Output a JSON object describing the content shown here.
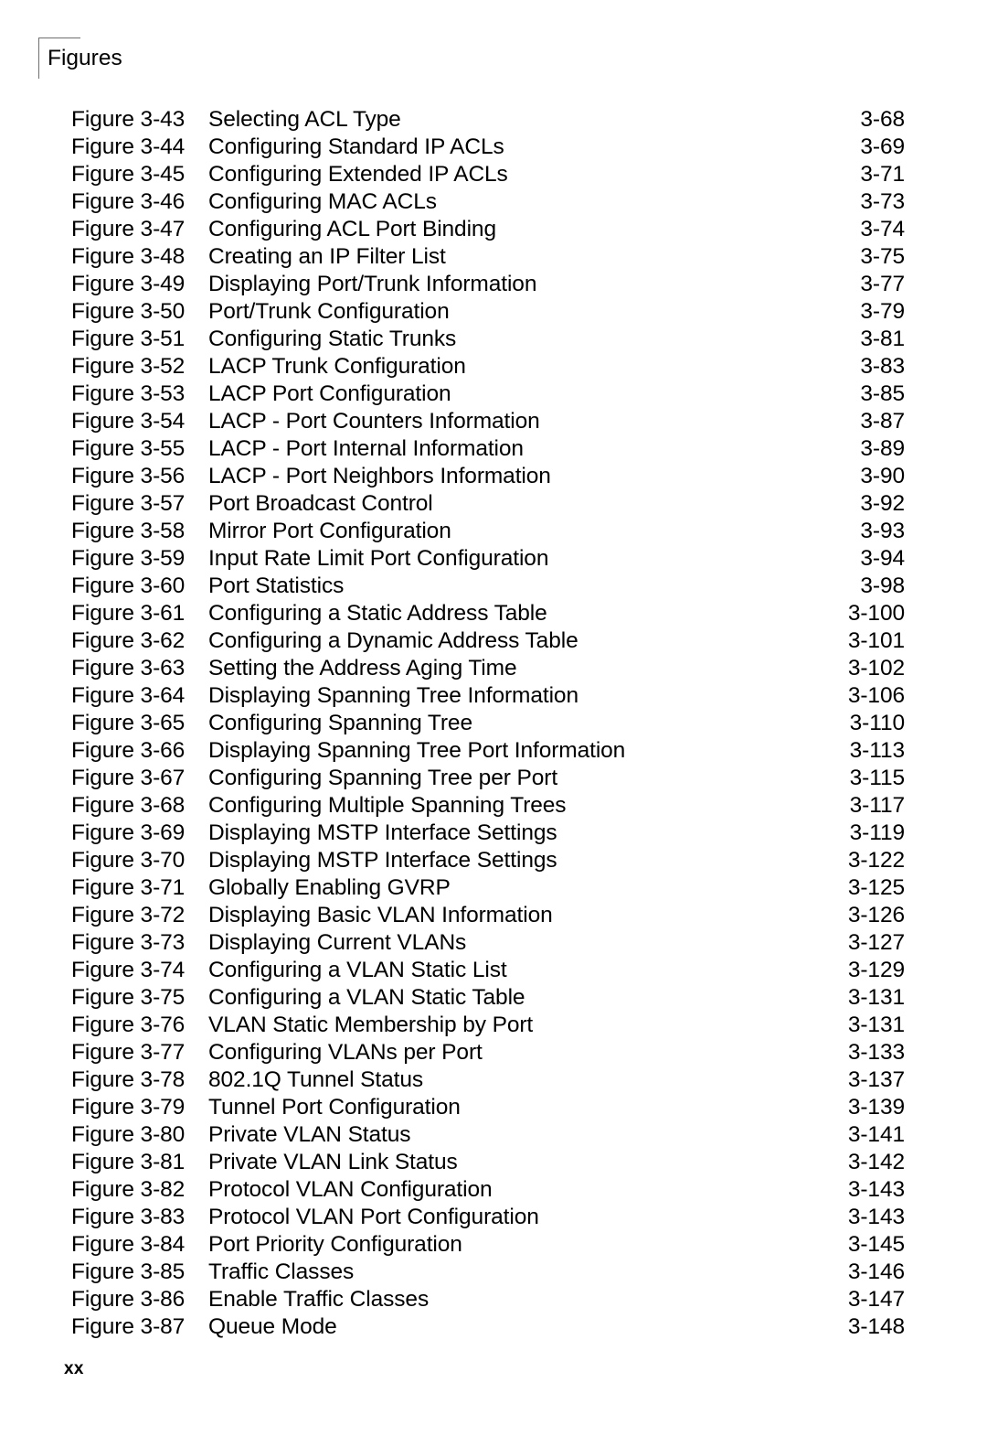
{
  "header": {
    "running_head": "Figures"
  },
  "footer": {
    "page_number": "xx"
  },
  "figure_list": {
    "rows": [
      {
        "label": "Figure 3-43",
        "title": "Selecting ACL Type",
        "page": "3-68"
      },
      {
        "label": "Figure 3-44",
        "title": "Configuring Standard IP ACLs",
        "page": "3-69"
      },
      {
        "label": "Figure 3-45",
        "title": "Configuring Extended IP ACLs",
        "page": "3-71"
      },
      {
        "label": "Figure 3-46",
        "title": "Configuring MAC ACLs",
        "page": "3-73"
      },
      {
        "label": "Figure 3-47",
        "title": "Configuring ACL Port Binding",
        "page": "3-74"
      },
      {
        "label": "Figure 3-48",
        "title": "Creating an IP Filter List",
        "page": "3-75"
      },
      {
        "label": "Figure 3-49",
        "title": "Displaying Port/Trunk Information",
        "page": "3-77"
      },
      {
        "label": "Figure 3-50",
        "title": "Port/Trunk Configuration",
        "page": "3-79"
      },
      {
        "label": "Figure 3-51",
        "title": "Configuring Static Trunks",
        "page": "3-81"
      },
      {
        "label": "Figure 3-52",
        "title": "LACP Trunk Configuration",
        "page": "3-83"
      },
      {
        "label": "Figure 3-53",
        "title": "LACP Port Configuration",
        "page": "3-85"
      },
      {
        "label": "Figure 3-54",
        "title": "LACP - Port Counters Information",
        "page": "3-87"
      },
      {
        "label": "Figure 3-55",
        "title": "LACP - Port Internal Information",
        "page": "3-89"
      },
      {
        "label": "Figure 3-56",
        "title": "LACP - Port Neighbors Information",
        "page": "3-90"
      },
      {
        "label": "Figure 3-57",
        "title": "Port Broadcast Control",
        "page": "3-92"
      },
      {
        "label": "Figure 3-58",
        "title": "Mirror Port Configuration",
        "page": "3-93"
      },
      {
        "label": "Figure 3-59",
        "title": "Input Rate Limit Port Configuration",
        "page": "3-94"
      },
      {
        "label": "Figure 3-60",
        "title": "Port Statistics",
        "page": "3-98"
      },
      {
        "label": "Figure 3-61",
        "title": "Configuring a Static Address Table",
        "page": "3-100"
      },
      {
        "label": "Figure 3-62",
        "title": "Configuring a Dynamic Address Table",
        "page": "3-101"
      },
      {
        "label": "Figure 3-63",
        "title": "Setting the Address Aging Time",
        "page": "3-102"
      },
      {
        "label": "Figure 3-64",
        "title": "Displaying Spanning Tree Information",
        "page": "3-106"
      },
      {
        "label": "Figure 3-65",
        "title": "Configuring Spanning Tree",
        "page": "3-110"
      },
      {
        "label": "Figure 3-66",
        "title": "Displaying Spanning Tree Port Information",
        "page": "3-113"
      },
      {
        "label": "Figure 3-67",
        "title": "Configuring Spanning Tree per Port",
        "page": "3-115"
      },
      {
        "label": "Figure 3-68",
        "title": "Configuring Multiple Spanning Trees",
        "page": "3-117"
      },
      {
        "label": "Figure 3-69",
        "title": "Displaying MSTP Interface Settings",
        "page": "3-119"
      },
      {
        "label": "Figure 3-70",
        "title": "Displaying MSTP Interface Settings",
        "page": "3-122"
      },
      {
        "label": "Figure 3-71",
        "title": "Globally Enabling GVRP",
        "page": "3-125"
      },
      {
        "label": "Figure 3-72",
        "title": "Displaying Basic VLAN Information",
        "page": "3-126"
      },
      {
        "label": "Figure 3-73",
        "title": "Displaying Current VLANs",
        "page": "3-127"
      },
      {
        "label": "Figure 3-74",
        "title": "Configuring a VLAN Static List",
        "page": "3-129"
      },
      {
        "label": "Figure 3-75",
        "title": "Configuring a VLAN Static Table",
        "page": "3-131"
      },
      {
        "label": "Figure 3-76",
        "title": "VLAN Static Membership by Port",
        "page": "3-131"
      },
      {
        "label": "Figure 3-77",
        "title": "Configuring VLANs per Port",
        "page": "3-133"
      },
      {
        "label": "Figure 3-78",
        "title": "802.1Q Tunnel Status",
        "page": "3-137"
      },
      {
        "label": "Figure 3-79",
        "title": "Tunnel Port Configuration",
        "page": "3-139"
      },
      {
        "label": "Figure 3-80",
        "title": "Private VLAN Status",
        "page": "3-141"
      },
      {
        "label": "Figure 3-81",
        "title": "Private VLAN Link Status",
        "page": "3-142"
      },
      {
        "label": "Figure 3-82",
        "title": "Protocol VLAN Configuration",
        "page": "3-143"
      },
      {
        "label": "Figure 3-83",
        "title": "Protocol VLAN Port Configuration",
        "page": "3-143"
      },
      {
        "label": "Figure 3-84",
        "title": "Port Priority Configuration",
        "page": "3-145"
      },
      {
        "label": "Figure 3-85",
        "title": "Traffic Classes",
        "page": "3-146"
      },
      {
        "label": "Figure 3-86",
        "title": "Enable Traffic Classes",
        "page": "3-147"
      },
      {
        "label": "Figure 3-87",
        "title": "Queue Mode",
        "page": "3-148"
      }
    ]
  }
}
